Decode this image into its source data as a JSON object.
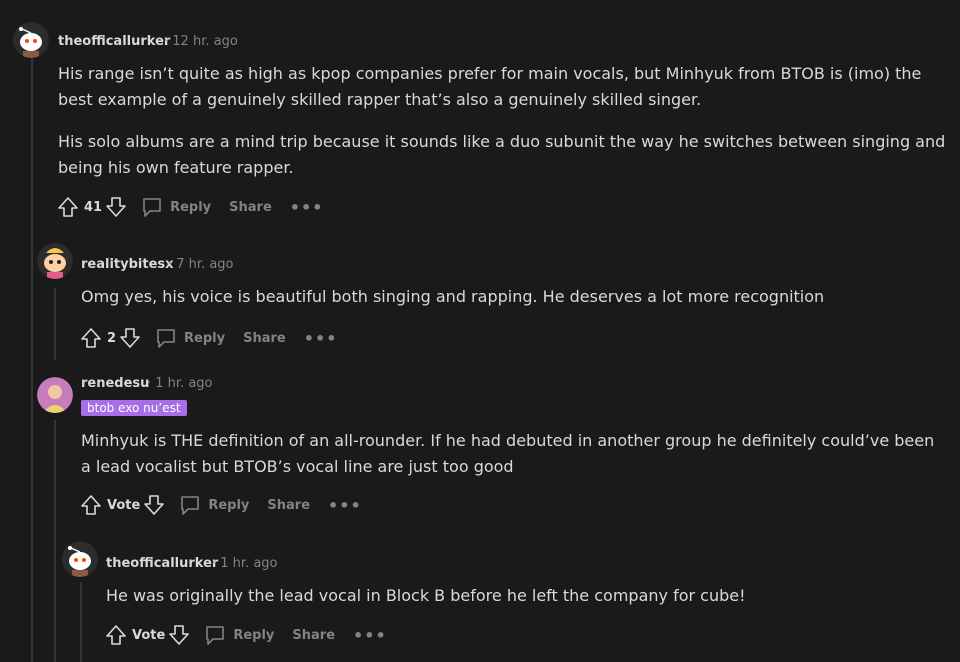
{
  "comments": [
    {
      "author": "theofficallurker",
      "time": "12 hr. ago",
      "paragraphs": [
        "His range isn’t quite as high as kpop companies prefer for main vocals, but Minhyuk from BTOB is (imo) the best example of a genuinely skilled rapper that’s also a genuinely skilled singer.",
        "His solo albums are a mind trip because it sounds like a duo subunit the way he switches between singing and being his own feature rapper."
      ],
      "votes": "41",
      "reply_label": "Reply",
      "share_label": "Share",
      "more_label": "•••"
    },
    {
      "author": "realitybitesx",
      "time": "7 hr. ago",
      "paragraphs": [
        "Omg yes, his voice is beautiful both singing and rapping. He deserves a lot more recognition"
      ],
      "votes": "2",
      "reply_label": "Reply",
      "share_label": "Share",
      "more_label": "•••"
    },
    {
      "author": "renedesu",
      "time": "1 hr. ago",
      "flair": "btob exo nu’est",
      "paragraphs": [
        "Minhyuk is THE definition of an all-rounder. If he had debuted in another group he definitely could’ve been a lead vocalist but BTOB’s vocal line are just too good"
      ],
      "votes": "Vote",
      "reply_label": "Reply",
      "share_label": "Share",
      "more_label": "•••"
    },
    {
      "author": "theofficallurker",
      "time": "1 hr. ago",
      "paragraphs": [
        "He was originally the lead vocal in Block B before he left the company for cube!"
      ],
      "votes": "Vote",
      "reply_label": "Reply",
      "share_label": "Share",
      "more_label": "•••"
    }
  ],
  "separator": "·",
  "colors": {
    "background": "#1a1a1b",
    "text": "#d7dadc",
    "muted": "#818384",
    "flair": "#a86ee8",
    "thread_line": "#343536"
  }
}
